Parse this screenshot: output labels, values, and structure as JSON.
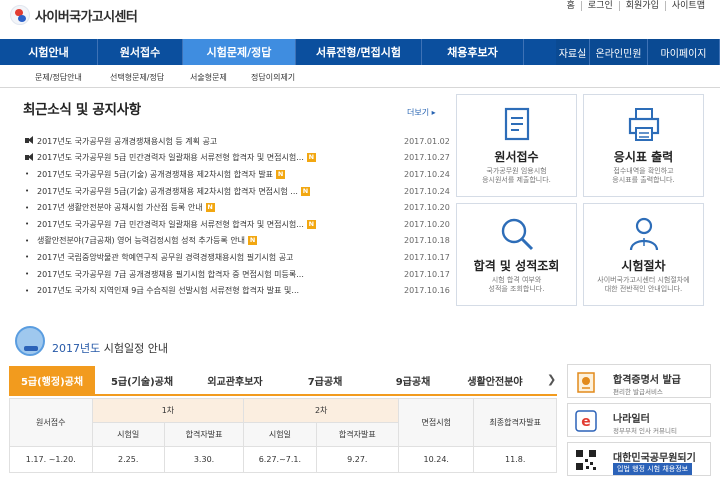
{
  "site": {
    "logo": "사이버국가고시센터"
  },
  "util": [
    "홈",
    "로그인",
    "회원가입",
    "사이트맵"
  ],
  "gnb": [
    "시험안내",
    "원서접수",
    "시험문제/정답",
    "서류전형/면접시험",
    "채용후보자"
  ],
  "gnb_right": [
    "자료실",
    "온라인민원",
    "마이페이지"
  ],
  "snb": [
    "문제/정답안내",
    "선택형문제/정답",
    "서술형문제",
    "정답이의제기"
  ],
  "notices": {
    "title": "최근소식 및 공지사항",
    "more": "더보기",
    "items": [
      {
        "marker": "speaker",
        "text": "2017년도 국가공무원 공개경쟁채용시험 등 계획 공고",
        "new": false,
        "date": "2017.01.02"
      },
      {
        "marker": "speaker",
        "text": "2017년도 국가공무원 5급 민간경력자 일괄채용 서류전형 합격자 및 면접시험...",
        "new": true,
        "date": "2017.10.27"
      },
      {
        "marker": "bullet",
        "text": "2017년도 국가공무원 5급(기술) 공개경쟁채용 제2차시험 합격자 발표",
        "new": true,
        "date": "2017.10.24"
      },
      {
        "marker": "bullet",
        "text": "2017년도 국가공무원 5급(기술) 공개경쟁채용 제2차시험 합격자 면접시험 ...",
        "new": true,
        "date": "2017.10.24"
      },
      {
        "marker": "bullet",
        "text": "2017년 생활안전분야 공채시험 가산점 등록 안내",
        "new": true,
        "date": "2017.10.20"
      },
      {
        "marker": "bullet",
        "text": "2017년도 국가공무원 7급 민간경력자 일괄채용 서류전형 합격자 및 면접시험...",
        "new": true,
        "date": "2017.10.20"
      },
      {
        "marker": "bullet",
        "text": "생활안전분야(7급공채) 영어 능력검정시험 성적 추가등록 안내",
        "new": true,
        "date": "2017.10.18"
      },
      {
        "marker": "bullet",
        "text": "2017년 국립중앙박물관 학예연구직 공무원 경력경쟁채용시험 필기시험 공고",
        "new": false,
        "date": "2017.10.17"
      },
      {
        "marker": "bullet",
        "text": "2017년도 국가공무원 7급 공개경쟁채용 필기시험 합격자 중 면접시험 미등록...",
        "new": false,
        "date": "2017.10.17"
      },
      {
        "marker": "bullet",
        "text": "2017년도 국가직 지역인재 9급 수습직원 선발시험 서류전형 합격자 발표 및...",
        "new": false,
        "date": "2017.10.16"
      }
    ]
  },
  "tiles": [
    {
      "icon": "document-icon",
      "title": "원서접수",
      "desc": "국가공무원 임용시험\n응시원서를 제출합니다."
    },
    {
      "icon": "printer-icon",
      "title": "응시표 출력",
      "desc": "접수내역을 확인하고\n응시표를 출력합니다."
    },
    {
      "icon": "magnifier-icon",
      "title": "합격 및 성적조회",
      "desc": "시험 합격 여부와\n성적을 조회합니다."
    },
    {
      "icon": "person-icon",
      "title": "시험절차",
      "desc": "사이버국가고시센터 시험절차에\n대한 전반적인 안내입니다."
    }
  ],
  "schedule": {
    "year": "2017년도",
    "title_rest": "시험일정 안내",
    "tabs": [
      "5급(행정)공채",
      "5급(기술)공채",
      "외교관후보자",
      "7급공채",
      "9급공채",
      "생활안전분야"
    ],
    "active_tab": 0,
    "headers": {
      "apply": "원서접수",
      "round1": "1차",
      "round2": "2차",
      "interview": "면접시험",
      "final": "최종합격자발표",
      "exam_day": "시험일",
      "pass": "합격자발표"
    },
    "row": {
      "apply": "1.17. ~1.20.",
      "r1_exam": "2.25.",
      "r1_pass": "3.30.",
      "r2_exam": "6.27.~7.1.",
      "r2_pass": "9.27.",
      "interview": "10.24.",
      "final": "11.8."
    }
  },
  "side_banners": [
    {
      "icon": "certificate-icon",
      "title": "합격증명서 발급",
      "sub": "편리한 발급서비스"
    },
    {
      "icon": "nara-icon",
      "title": "나라일터",
      "sub": "정부부처 인사 커뮤니티"
    },
    {
      "icon": "qr-code-icon",
      "title": "대한민국공무원되기",
      "sub": "입법 행정 시험 채용정보"
    }
  ],
  "colors": {
    "nav": "#0b4f9e",
    "nav_active": "#3f8de0",
    "tab_active": "#f29b1e",
    "new_badge": "#f2a711"
  }
}
